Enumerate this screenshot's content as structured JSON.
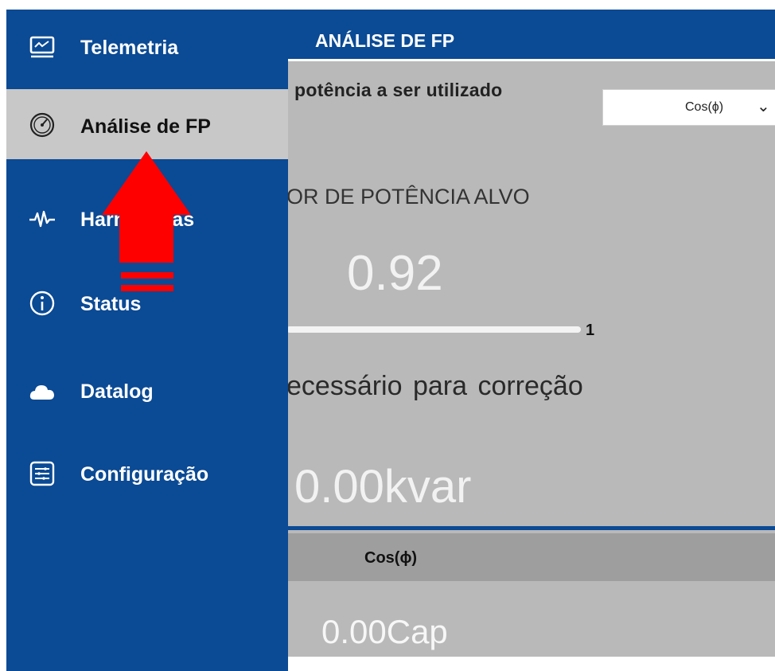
{
  "header": {
    "title": "ANÁLISE DE FP"
  },
  "sidebar": {
    "items": [
      {
        "label": "Telemetria",
        "icon": "monitor-icon",
        "active": false
      },
      {
        "label": "Análise de FP",
        "icon": "gauge-icon",
        "active": true
      },
      {
        "label": "Harmônicas",
        "icon": "waveform-icon",
        "active": false
      },
      {
        "label": "Status",
        "icon": "info-icon",
        "active": false
      },
      {
        "label": "Datalog",
        "icon": "cloud-icon",
        "active": false
      },
      {
        "label": "Configuração",
        "icon": "settings-panel-icon",
        "active": false
      }
    ]
  },
  "main": {
    "power_type_label": "potência a ser utilizado",
    "power_type_select": {
      "value": "Cos(ϕ)"
    },
    "target_label": "OR DE POTÊNCIA ALVO",
    "target_value": "0.92",
    "slider_max": "1",
    "needed_label": "ecessário para correção",
    "kvar_value": "0.00kvar",
    "table": {
      "header": "Cos(ϕ)",
      "value": "0.00Cap"
    }
  },
  "colors": {
    "sidebar_bg": "#0b4a94",
    "content_bg": "#b9b9b9",
    "active_item_bg": "#c8c8c8",
    "arrow": "#ff0000"
  }
}
